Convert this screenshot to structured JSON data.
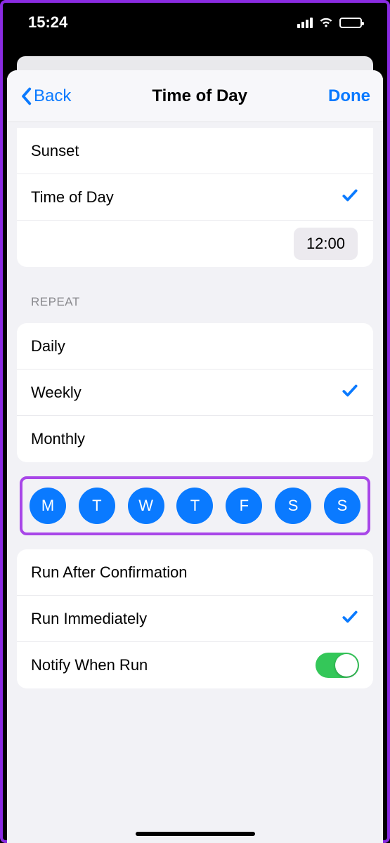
{
  "status": {
    "time": "15:24"
  },
  "nav": {
    "back": "Back",
    "title": "Time of Day",
    "done": "Done"
  },
  "triggers": {
    "sunset": "Sunset",
    "time_of_day": "Time of Day",
    "time_value": "12:00"
  },
  "repeat": {
    "header": "REPEAT",
    "daily": "Daily",
    "weekly": "Weekly",
    "monthly": "Monthly"
  },
  "days": [
    "M",
    "T",
    "W",
    "T",
    "F",
    "S",
    "S"
  ],
  "run": {
    "after_confirm": "Run After Confirmation",
    "immediately": "Run Immediately",
    "notify": "Notify When Run"
  }
}
